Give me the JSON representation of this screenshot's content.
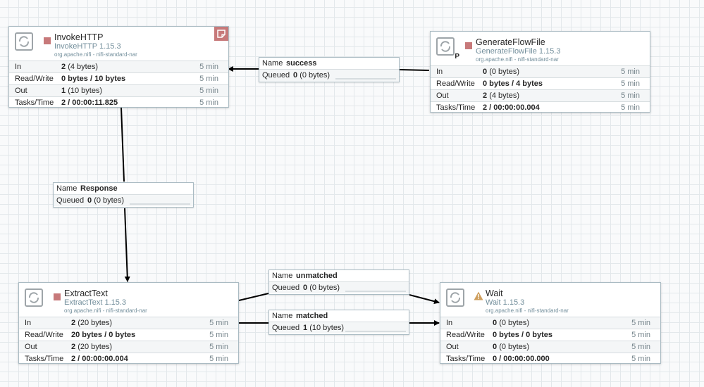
{
  "processors": {
    "invoke": {
      "name": "InvokeHTTP",
      "type": "InvokeHTTP 1.15.3",
      "bundle": "org.apache.nifi - nifi-standard-nar",
      "state_icon": "stopped-icon",
      "has_comments": true,
      "stats": {
        "in_count": "2",
        "in_size": "(4 bytes)",
        "in_time": "5 min",
        "rw": "0 bytes / 10 bytes",
        "rw_time": "5 min",
        "out_count": "1",
        "out_size": "(10 bytes)",
        "out_time": "5 min",
        "tasks": "2 / 00:00:11.825",
        "tasks_time": "5 min"
      }
    },
    "generate": {
      "name": "GenerateFlowFile",
      "type": "GenerateFlowFile 1.15.3",
      "bundle": "org.apache.nifi - nifi-standard-nar",
      "primary_label": "P",
      "state_icon": "stopped-icon",
      "stats": {
        "in_count": "0",
        "in_size": "(0 bytes)",
        "in_time": "5 min",
        "rw": "0 bytes / 4 bytes",
        "rw_time": "5 min",
        "out_count": "2",
        "out_size": "(4 bytes)",
        "out_time": "5 min",
        "tasks": "2 / 00:00:00.004",
        "tasks_time": "5 min"
      }
    },
    "extract": {
      "name": "ExtractText",
      "type": "ExtractText 1.15.3",
      "bundle": "org.apache.nifi - nifi-standard-nar",
      "state_icon": "stopped-icon",
      "stats": {
        "in_count": "2",
        "in_size": "(20 bytes)",
        "in_time": "5 min",
        "rw": "20 bytes / 0 bytes",
        "rw_time": "5 min",
        "out_count": "2",
        "out_size": "(20 bytes)",
        "out_time": "5 min",
        "tasks": "2 / 00:00:00.004",
        "tasks_time": "5 min"
      }
    },
    "wait": {
      "name": "Wait",
      "type": "Wait 1.15.3",
      "bundle": "org.apache.nifi - nifi-standard-nar",
      "state_icon": "warning-icon",
      "stats": {
        "in_count": "0",
        "in_size": "(0 bytes)",
        "in_time": "5 min",
        "rw": "0 bytes / 0 bytes",
        "rw_time": "5 min",
        "out_count": "0",
        "out_size": "(0 bytes)",
        "out_time": "5 min",
        "tasks": "0 / 00:00:00.000",
        "tasks_time": "5 min"
      }
    }
  },
  "stat_labels": {
    "in": "In",
    "rw": "Read/Write",
    "out": "Out",
    "tasks": "Tasks/Time"
  },
  "connection_labels": {
    "name": "Name",
    "queued": "Queued"
  },
  "connections": {
    "success": {
      "name": "success",
      "queued_count": "0",
      "queued_size": "(0 bytes)"
    },
    "response": {
      "name": "Response",
      "queued_count": "0",
      "queued_size": "(0 bytes)"
    },
    "unmatched": {
      "name": "unmatched",
      "queued_count": "0",
      "queued_size": "(0 bytes)"
    },
    "matched": {
      "name": "matched",
      "queued_count": "1",
      "queued_size": "(10 bytes)"
    }
  },
  "colors": {
    "stopped": "#c7797a",
    "warning": "#cf9f5d",
    "border": "#aabbc3",
    "type_text": "#728e9b"
  }
}
